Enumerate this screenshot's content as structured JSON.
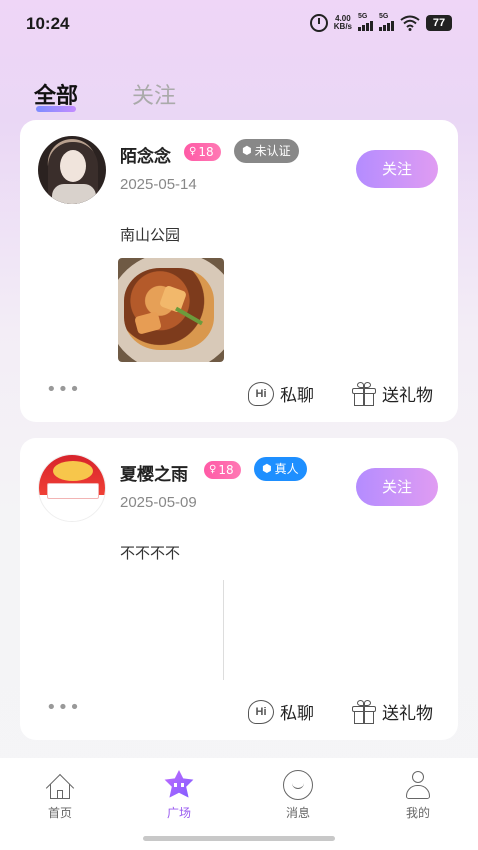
{
  "status_bar": {
    "time": "10:24",
    "net_speed_value": "4.00",
    "net_speed_unit": "KB/s",
    "signal1_label": "5G",
    "signal2_label": "5G",
    "battery": "77"
  },
  "tabs": [
    {
      "label": "全部",
      "active": true
    },
    {
      "label": "关注",
      "active": false
    }
  ],
  "posts": [
    {
      "username": "陌念念",
      "age": "18",
      "age_symbol": "♀",
      "cert_label": "未认证",
      "date": "2025-05-14",
      "follow_label": "关注",
      "text": "南山公园",
      "chat_label": "私聊",
      "gift_label": "送礼物",
      "more": "•••",
      "hi": "Hi"
    },
    {
      "username": "夏樱之雨",
      "age": "18",
      "age_symbol": "♀",
      "cert_label": "真人",
      "date": "2025-05-09",
      "follow_label": "关注",
      "text": "不不不不",
      "chat_label": "私聊",
      "gift_label": "送礼物",
      "more": "•••",
      "hi": "Hi"
    }
  ],
  "bottom_nav": [
    {
      "label": "首页",
      "icon": "home-icon",
      "active": false
    },
    {
      "label": "广场",
      "icon": "square-star-icon",
      "active": true
    },
    {
      "label": "消息",
      "icon": "message-icon",
      "active": false
    },
    {
      "label": "我的",
      "icon": "profile-icon",
      "active": false
    }
  ],
  "colors": {
    "accent": "#9b5cf0",
    "follow_gradient_start": "#b48cff",
    "follow_gradient_end": "#e09cf2",
    "age_badge": "#ff5aa6",
    "real_badge": "#1e8fff",
    "unverified_badge": "#888888"
  }
}
